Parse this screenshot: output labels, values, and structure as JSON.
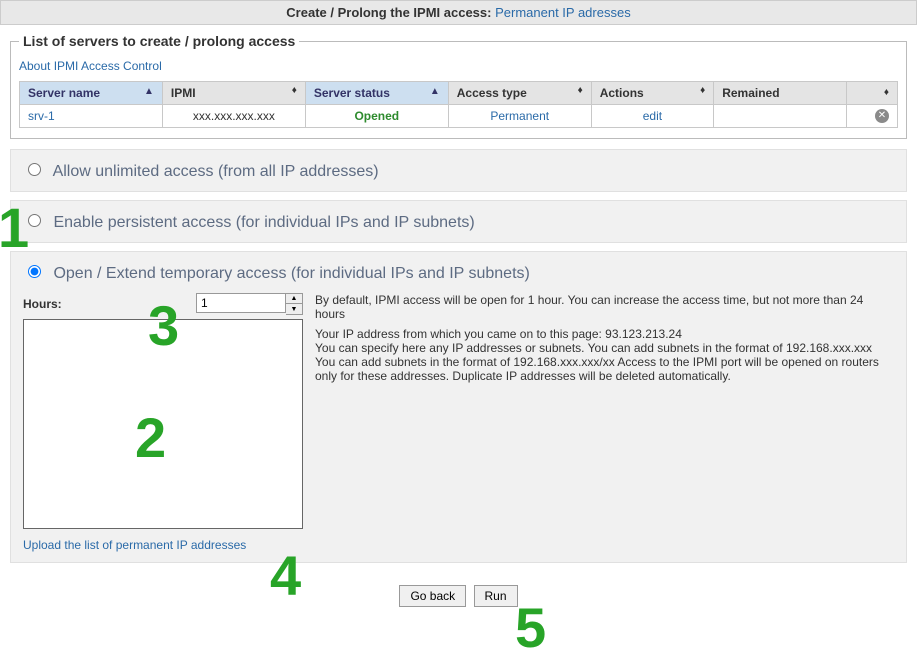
{
  "header": {
    "title": "Create / Prolong the IPMI access:",
    "subtitle": "Permanent IP adresses"
  },
  "fieldset": {
    "legend": "List of servers to create / prolong access",
    "about_link": "About IPMI Access Control"
  },
  "table": {
    "headers": {
      "server_name": "Server name",
      "ipmi": "IPMI",
      "server_status": "Server status",
      "access_type": "Access type",
      "actions": "Actions",
      "remained": "Remained"
    },
    "row": {
      "server_name": "srv-1",
      "ipmi": "xxx.xxx.xxx.xxx",
      "server_status": "Opened",
      "access_type": "Permanent",
      "actions": "edit",
      "remained": ""
    }
  },
  "options": {
    "unlimited": "Allow unlimited access (from all IP addresses)",
    "persistent": "Enable persistent access (for individual IPs and IP subnets)",
    "temporary": "Open / Extend temporary access (for individual IPs and IP subnets)"
  },
  "temp": {
    "hours_label": "Hours:",
    "hours_value": "1",
    "help_line1": "By default, IPMI access will be open for 1 hour. You can increase the access time, but not more than 24 hours",
    "help_line2": "Your IP address from which you came on to this page: 93.123.213.24",
    "help_line3": "You can specify here any IP addresses or subnets. You can add subnets in the format of 192.168.xxx.xxx",
    "help_line4": "You can add subnets in the format of 192.168.xxx.xxx/xx Access to the IPMI port will be opened on routers only for these addresses. Duplicate IP addresses will be deleted automatically.",
    "upload_link": "Upload the list of permanent IP addresses"
  },
  "buttons": {
    "go_back": "Go back",
    "run": "Run"
  },
  "annotations": {
    "n1": "1",
    "n2": "2",
    "n3": "3",
    "n4": "4",
    "n5": "5"
  }
}
